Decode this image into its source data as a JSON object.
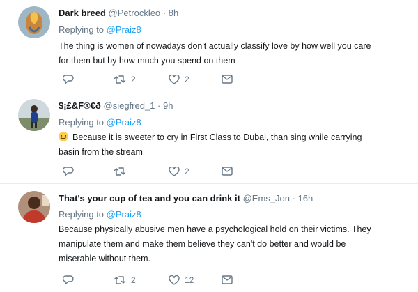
{
  "tweets": [
    {
      "name": "Dark breed",
      "handle": "@Petrockleo",
      "time": "· 8h",
      "replying_label": "Replying to",
      "replying_to": "@Praiz8",
      "lines": [
        "The thing is women of nowadays don't actually classify love by how well you care",
        "for them but by how much you spend on them"
      ],
      "reply_count": "",
      "retweet_count": "2",
      "like_count": "2"
    },
    {
      "name": "$¡£&F®€ð",
      "handle": "@siegfred_1",
      "time": "· 9h",
      "replying_label": "Replying to",
      "replying_to": "@Praiz8",
      "lines": [
        "Because it is sweeter to cry in First Class to Dubai, than sing while carrying",
        "basin from the stream"
      ],
      "emoji": "smiling-face-emoji",
      "reply_count": "",
      "retweet_count": "",
      "like_count": "2"
    },
    {
      "name": "That's your cup of tea and you can drink it",
      "handle": "@Ems_Jon",
      "time": "· 16h",
      "replying_label": "Replying to",
      "replying_to": "@Praiz8",
      "lines": [
        "Because physically abusive men have a psychological hold on their victims. They",
        "manipulate them and make them believe they can't do better and would be",
        "miserable without them."
      ],
      "reply_count": "",
      "retweet_count": "2",
      "like_count": "12"
    }
  ],
  "icons": {
    "reply": "reply-icon",
    "retweet": "retweet-icon",
    "like": "heart-icon",
    "message": "envelope-icon"
  },
  "colors": {
    "link": "#1da1f2",
    "secondary_text": "#657786",
    "divider": "#e6ecf0"
  }
}
